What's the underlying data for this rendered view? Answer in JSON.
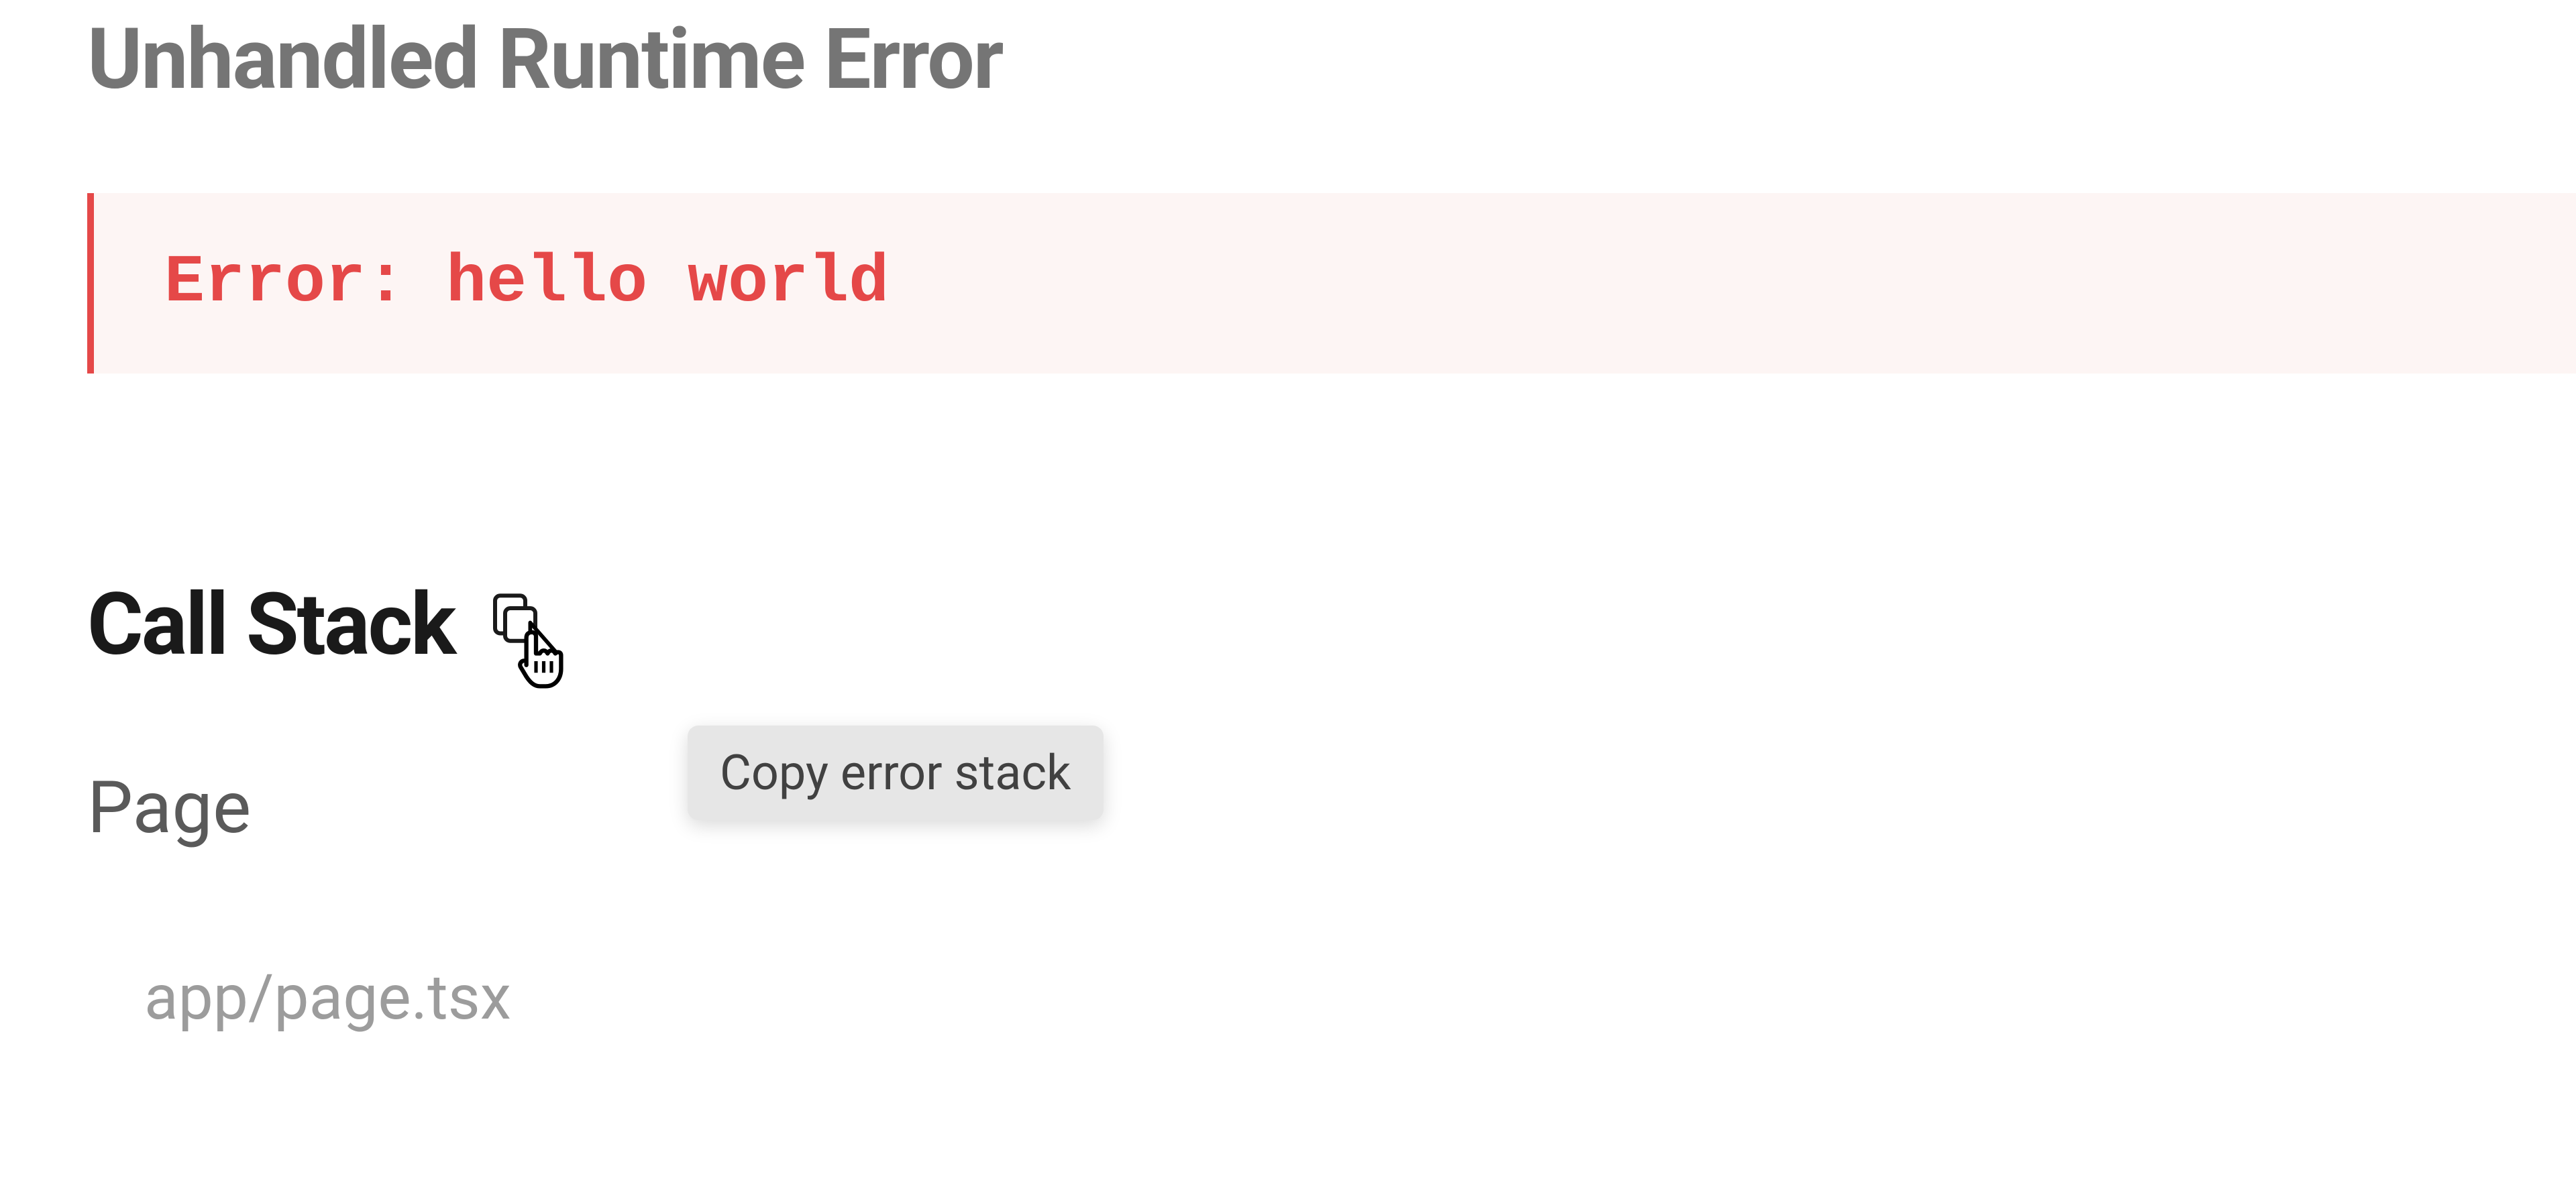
{
  "error": {
    "title": "Unhandled Runtime Error",
    "message": "Error: hello world"
  },
  "call_stack": {
    "heading": "Call Stack",
    "copy_tooltip": "Copy error stack",
    "frames": [
      {
        "name": "Page",
        "path": "app/page.tsx"
      }
    ]
  },
  "colors": {
    "error_red": "#e54848",
    "error_bg": "#fdf5f4",
    "title_grey": "#757575",
    "heading_black": "#1a1a1a",
    "tooltip_bg": "#e6e6e6"
  }
}
